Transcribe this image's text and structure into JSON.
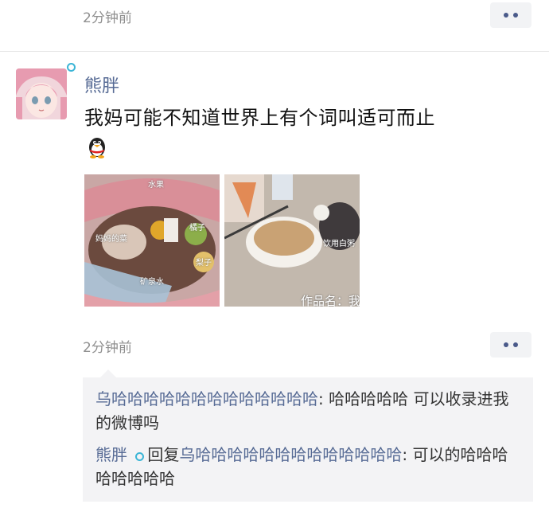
{
  "top_post": {
    "time": "2分钟前"
  },
  "post": {
    "username": "熊胖",
    "content": "我妈可能不知道世界上有个词叫适可而止",
    "emoji_icon": "qq-penguin-icon",
    "photos": [
      {
        "captions": [
          "妈妈的菜",
          "橘子",
          "矿泉水",
          "梨子",
          "水果"
        ]
      },
      {
        "captions": [
          "饮用白粥",
          "作品名：我"
        ]
      }
    ],
    "time": "2分钟前"
  },
  "comments": [
    {
      "author": "乌哈哈哈哈哈哈哈哈哈哈哈哈哈",
      "separator": ": ",
      "text": "哈哈哈哈哈 可以收录进我的微博吗"
    },
    {
      "author": "熊胖",
      "reply_word": "回复",
      "reply_to": "乌哈哈哈哈哈哈哈哈哈哈哈哈哈",
      "separator": ":",
      "text": "可以的哈哈哈哈哈哈哈哈"
    }
  ],
  "colors": {
    "name_blue": "#576b95",
    "ring_cyan": "#3bb5d6",
    "comment_bg": "#f3f3f5"
  }
}
